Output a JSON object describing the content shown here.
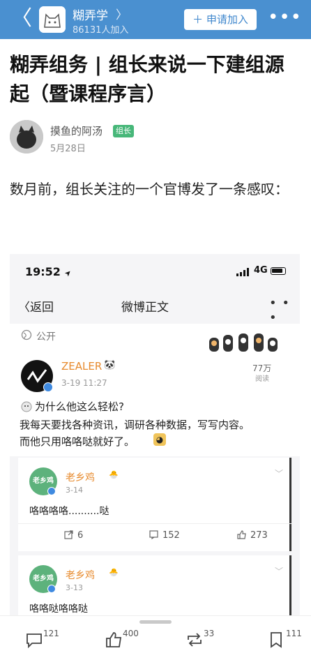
{
  "header": {
    "back_label": "〈",
    "group_name": "糊弄学",
    "group_chevron": "〉",
    "group_members": "86131人加入",
    "join_button": "＋ 申请加入",
    "more": "•••",
    "bar_color": "#4a90d0"
  },
  "article": {
    "title": "糊弄组务 | 组长来说一下建组源起（暨课程序言）",
    "author": "摸鱼的阿汤",
    "role_badge": "组长",
    "date": "5月28日",
    "intro": "数月前，组长关注的一个官博发了一条感叹："
  },
  "screenshot": {
    "status_time": "19:52",
    "status_arrow": "➤",
    "network": "4G",
    "nav_back": "〈返回",
    "nav_title": "微博正文",
    "nav_more": "• • •",
    "visibility": "公开",
    "post": {
      "author": "ZEALER",
      "author_emoji": "🐼",
      "time": "3-19 11:27",
      "views_count": "77万",
      "views_label": "阅读",
      "line1": "为什么他这么轻松?",
      "line2": "我每天要找各种资讯，调研各种数据，写写内容。",
      "line3": "而他只用咯咯哒就好了。"
    },
    "comments": [
      {
        "avatar_text": "老乡鸡",
        "author": "老乡鸡",
        "date": "3-14",
        "text": "咯咯咯咯..........哒",
        "share": "6",
        "comments": "152",
        "likes": "273"
      },
      {
        "avatar_text": "老乡鸡",
        "author": "老乡鸡",
        "date": "3-13",
        "text": "咯咯哒咯咯哒"
      }
    ],
    "accent_color": "#e78a2d"
  },
  "bottom_bar": {
    "comments": "121",
    "likes": "400",
    "reposts": "33",
    "collects": "111"
  }
}
